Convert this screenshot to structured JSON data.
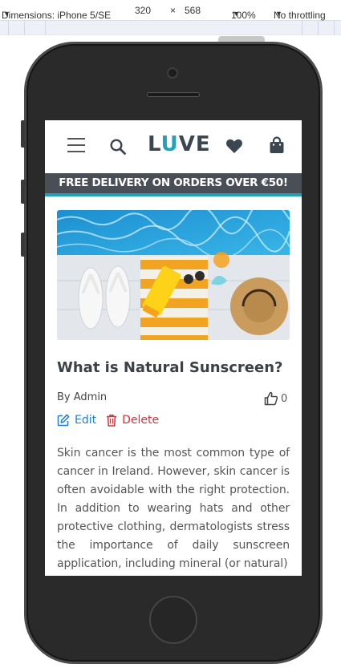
{
  "devtools": {
    "dimensions_label": "Dimensions: iPhone 5/SE",
    "width": "320",
    "times": "×",
    "height": "568",
    "zoom": "100%",
    "throttling": "No throttling"
  },
  "header": {
    "logo_pre": "L",
    "logo_accent": "U",
    "logo_post": "VE"
  },
  "banner": {
    "text": "FREE DELIVERY ON ORDERS OVER €50!"
  },
  "post": {
    "title": "What is Natural Sunscreen?",
    "author": "By Admin",
    "likes": "0",
    "edit_label": "Edit",
    "delete_label": "Delete",
    "body": "Skin cancer is the most common type of cancer in Ireland. However, skin cancer is often avoidable with the right protection. In addition to wearing hats and other protective clothing, dermatologists stress the importance of daily sunscreen application, including mineral (or natural)"
  },
  "colors": {
    "accent": "#1ea3b8",
    "banner_bg": "#4a4f57",
    "edit": "#1f7fd1",
    "delete": "#d6303b"
  }
}
